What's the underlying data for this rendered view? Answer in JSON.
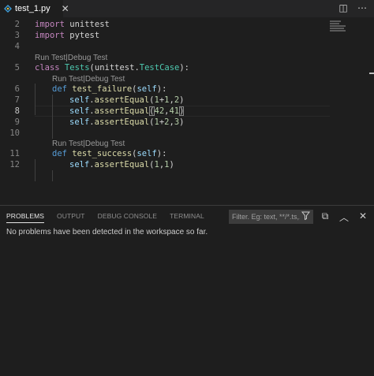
{
  "tab": {
    "label": "test_1.py",
    "close": "✕",
    "icon": "python-file-icon"
  },
  "editor_actions": {
    "split": "◫",
    "more": "⋯"
  },
  "code_lens": {
    "run": "Run Test",
    "sep": " | ",
    "debug": "Debug Test"
  },
  "lines": [
    {
      "num": "2",
      "tokens": [
        "import",
        " unittest"
      ]
    },
    {
      "num": "3",
      "tokens": [
        "import",
        " pytest"
      ]
    },
    {
      "num": "4",
      "tokens": []
    },
    {
      "num": "5",
      "tokens": [
        "class",
        " Tests",
        "(",
        "unittest",
        ".",
        "TestCase",
        "):"
      ]
    },
    {
      "num": "6",
      "tokens": [
        "def",
        " test_failure",
        "(",
        "self",
        "):"
      ]
    },
    {
      "num": "7",
      "tokens": [
        "self",
        ".",
        "assertEqual",
        "(",
        "1",
        "+",
        "1",
        ",",
        "2",
        ")"
      ]
    },
    {
      "num": "8",
      "tokens": [
        "self",
        ".",
        "assertEqual",
        "(",
        "42",
        ",",
        "41",
        ")"
      ]
    },
    {
      "num": "9",
      "tokens": [
        "self",
        ".",
        "assertEqual",
        "(",
        "1",
        "+",
        "2",
        ",",
        "3",
        ")"
      ]
    },
    {
      "num": "10",
      "tokens": []
    },
    {
      "num": "11",
      "tokens": [
        "def",
        " test_success",
        "(",
        "self",
        "):"
      ]
    },
    {
      "num": "12",
      "tokens": [
        "self",
        ".",
        "assertEqual",
        "(",
        "1",
        ",",
        "1",
        ")"
      ]
    }
  ],
  "active_line": "8",
  "panel": {
    "tabs": [
      "PROBLEMS",
      "OUTPUT",
      "DEBUG CONSOLE",
      "TERMINAL"
    ],
    "active_tab": "PROBLEMS",
    "filter_placeholder": "Filter. Eg: text, **/*.ts,...",
    "filter_icon": "filter-icon",
    "actions": {
      "collapse": "⧉",
      "maximize": "︿",
      "close": "✕"
    },
    "message": "No problems have been detected in the workspace so far."
  },
  "colors": {
    "keyword": "#c586c0",
    "def": "#569cd6",
    "class_name": "#4ec9b0",
    "function": "#dcdcaa",
    "self": "#9cdcfe",
    "number": "#b5cea8"
  }
}
